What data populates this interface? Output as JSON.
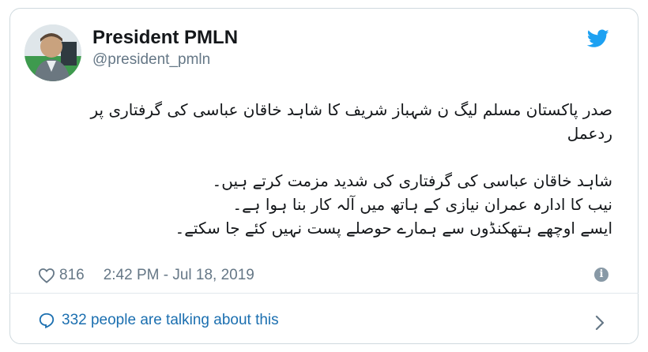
{
  "author": {
    "name": "President PMLN",
    "handle": "@president_pmln"
  },
  "tweet": {
    "text": "صدر پاکستان مسلم لیگ ن شہباز شریف کا شاہد خاقان عباسی کی گرفتاری پر\nردعمل\n\nشاہد خاقان عباسی کی گرفتاری کی شدید مزمت کرتے ہیں۔\nنیب کا ادارہ عمران نیازی کے ہاتھ میں آلہ کار بنا ہوا ہے۔\nایسے اوچھے ہتھکنڈوں سے ہمارے حوصلے پست نہیں کئے جا سکتے۔"
  },
  "meta": {
    "likes": "816",
    "timestamp": "2:42 PM - Jul 18, 2019"
  },
  "footer": {
    "talking": "332 people are talking about this"
  },
  "icons": {
    "heart": "heart-icon",
    "twitter": "twitter-bird-icon",
    "info": "info-icon",
    "comment": "comment-icon",
    "chevron": "chevron-right-icon"
  },
  "colors": {
    "twitter_blue": "#1da1f2",
    "link_blue": "#1b6fb0",
    "muted": "#657786"
  }
}
